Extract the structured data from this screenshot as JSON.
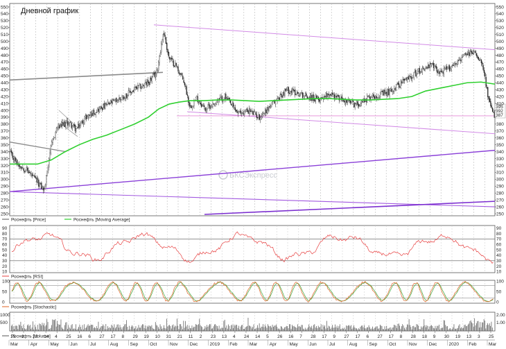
{
  "chart_data": {
    "title": "Дневной график",
    "type": "candlestick",
    "watermark": "БКСЭкспресс",
    "price_axis": {
      "ylim": [
        247,
        555
      ],
      "ticks": [
        250,
        260,
        270,
        280,
        290,
        300,
        310,
        320,
        330,
        340,
        350,
        360,
        370,
        380,
        390,
        400,
        410,
        420,
        430,
        440,
        450,
        460,
        470,
        480,
        490,
        500,
        510,
        520,
        530,
        540,
        550
      ],
      "right_tags": [
        "395",
        "392",
        "387"
      ]
    },
    "rsi_axis": {
      "ylim": [
        8,
        95
      ],
      "ticks": [
        10,
        20,
        30,
        40,
        50,
        60,
        70,
        80,
        90
      ],
      "levels": [
        70,
        30
      ]
    },
    "stoch_axis": {
      "ylim": [
        -5,
        105
      ],
      "ticks": [
        0,
        50,
        100
      ],
      "levels": [
        80,
        20
      ]
    },
    "vol_axis": {
      "left_ticks": [
        "1000",
        "500"
      ],
      "right_ticks": [
        "2.00",
        "1.00"
      ]
    },
    "x_axis": {
      "top": [
        "15",
        "2",
        "23",
        "14",
        "4",
        "25",
        "16",
        "6",
        "27",
        "17",
        "8",
        "29",
        "19",
        "10",
        "31",
        "21",
        "11",
        "2",
        "23",
        "13",
        "4",
        "24",
        "14",
        "5",
        "26",
        "16",
        "7",
        "28",
        "17",
        "9",
        "27",
        "17",
        "6",
        "27",
        "17",
        "8",
        "28",
        "18",
        "9",
        "30",
        "19",
        "13",
        "3",
        "25"
      ],
      "bottom": [
        "Mar",
        "Apr",
        "May",
        "Jun",
        "Jul",
        "Aug",
        "Sep",
        "Oct",
        "Nov",
        "Dec",
        "2019",
        "Feb",
        "Mar",
        "Apr",
        "May",
        "Jun",
        "Jul",
        "Aug",
        "Sep",
        "Oct",
        "Nov",
        "Dec",
        "2020",
        "Feb",
        "Mar"
      ]
    },
    "legends": {
      "price": "Роснефть [Price]",
      "ma": "Роснефть [Moving Average]",
      "rsi": "Роснефть [RSI]",
      "stoch": "Роснефть [Stochastic]",
      "volume": "Роснефть [Volume]"
    },
    "series": [
      {
        "name": "Роснефть [Price]",
        "x": [
          0,
          12,
          25,
          40,
          50,
          58,
          68,
          85,
          96,
          110,
          125,
          145,
          165,
          180,
          200,
          212,
          222,
          230,
          240,
          252,
          260,
          270,
          282,
          295,
          310,
          330,
          345,
          360,
          380,
          400,
          415,
          430,
          445,
          460,
          480,
          500,
          520,
          545,
          565,
          580,
          595,
          610,
          620,
          632,
          645,
          658,
          670,
          682,
          690,
          695,
          700
        ],
        "values": [
          338,
          322,
          313,
          296,
          284,
          340,
          375,
          382,
          372,
          390,
          400,
          410,
          420,
          430,
          440,
          455,
          515,
          475,
          465,
          440,
          405,
          418,
          402,
          410,
          420,
          395,
          400,
          390,
          410,
          430,
          425,
          420,
          415,
          425,
          415,
          408,
          420,
          425,
          440,
          450,
          460,
          465,
          455,
          460,
          470,
          480,
          485,
          470,
          420,
          400,
          392
        ]
      },
      {
        "name": "Роснефть [Moving Average]",
        "x": [
          0,
          20,
          40,
          60,
          80,
          100,
          120,
          140,
          160,
          180,
          200,
          215,
          230,
          245,
          260,
          280,
          300,
          320,
          340,
          360,
          380,
          400,
          420,
          440,
          460,
          480,
          500,
          520,
          540,
          560,
          580,
          600,
          620,
          640,
          660,
          680,
          700
        ],
        "values": [
          322,
          322,
          322,
          328,
          340,
          350,
          358,
          364,
          372,
          380,
          390,
          402,
          409,
          412,
          414,
          414,
          415,
          415,
          414,
          413,
          414,
          415,
          416,
          417,
          417,
          416,
          415,
          415,
          416,
          417,
          420,
          428,
          432,
          436,
          440,
          441,
          438
        ]
      }
    ]
  }
}
